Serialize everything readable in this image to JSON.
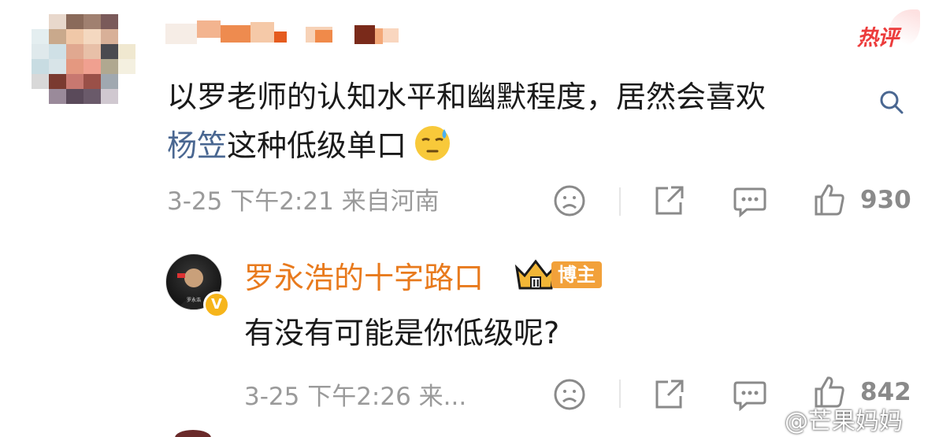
{
  "comment": {
    "badge": "热评",
    "text_line1": "以罗老师的认知水平和幽默程度，居然会喜欢",
    "mention": "杨笠",
    "text_line2_rest": "这种低级单口",
    "emoji": "sweat-emoji",
    "meta": "3-25 下午2:21 来自河南",
    "likes": "930",
    "icons": [
      "sad-face-icon",
      "share-icon",
      "comment-icon",
      "like-icon"
    ]
  },
  "reply": {
    "author": "罗永浩的十字路口",
    "tag": "博主",
    "text": "有没有可能是你低级呢?",
    "meta": "3-25 下午2:26 来...",
    "likes": "842"
  },
  "watermark": "@芒果妈妈",
  "colors": {
    "mention": "#4a6791",
    "author": "#e87a1d",
    "hot": "#ec3c3c",
    "meta": "#9a9a9a"
  }
}
